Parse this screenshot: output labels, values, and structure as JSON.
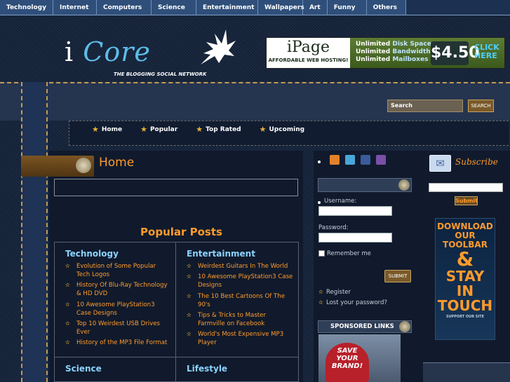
{
  "top_nav": [
    "Technology",
    "Internet",
    "Computers",
    "Science",
    "Entertainment",
    "Wallpapers",
    "Art",
    "Funny",
    "Others"
  ],
  "logo": {
    "i": "i",
    "core": "Core",
    "tagline": "THE BLOGGING SOCIAL NETWORK"
  },
  "ad": {
    "brand": "iPage",
    "sub": "AFFORDABLE WEB HOSTING!",
    "line1_a": "Unlimited",
    "line1_b": "Disk Space",
    "line2_a": "Unlimited",
    "line2_b": "Bandwidth",
    "line3_a": "Unlimited",
    "line3_b": "Mailboxes",
    "price": "$4.50",
    "click": "CLICK HERE"
  },
  "search": {
    "placeholder": "Search",
    "button": "SEARCH"
  },
  "main_nav": [
    "Home",
    "Popular",
    "Top Rated",
    "Upcoming"
  ],
  "content": {
    "title": "Home",
    "popular_title": "Popular Posts",
    "categories": [
      {
        "name": "Technology",
        "posts": [
          "Evolution of Some Popular Tech Logos",
          "History Of Blu-Ray Technology & HD DVD",
          "10 Awesome PlayStation3 Case Designs",
          "Top 10 Weirdest USB Drives Ever",
          "History of the MP3 File Format"
        ]
      },
      {
        "name": "Entertainment",
        "posts": [
          "Weirdest Guitars In The World",
          "10 Awesome PlayStation3 Case Designs",
          "The 10 Best Cartoons Of The 90's",
          "Tips & Tricks to Master Farmville on Facebook",
          "World's Most Expensive MP3 Player"
        ]
      },
      {
        "name": "Science",
        "posts": []
      },
      {
        "name": "Lifestyle",
        "posts": []
      }
    ]
  },
  "login": {
    "username_label": "Username:",
    "password_label": "Password:",
    "remember": "Remember me",
    "submit": "SUBMIT",
    "register": "Register",
    "lost": "Lost your password?",
    "sponsored": "SPONSORED LINKS",
    "save_ad": "SAVE YOUR BRAND!"
  },
  "subscribe": {
    "title": "Subscribe",
    "submit": "Submit",
    "ad_l1": "DOWNLOAD OUR TOOLBAR",
    "ad_amp": "&",
    "ad_l2": "STAY IN TOUCH",
    "ad_l3": "SUPPORT OUR SITE"
  },
  "colors": {
    "accent": "#ff9b2c",
    "link_blue": "#8bd3ff",
    "nav_bg": "#2f4f7a",
    "denim": "#16243c"
  }
}
